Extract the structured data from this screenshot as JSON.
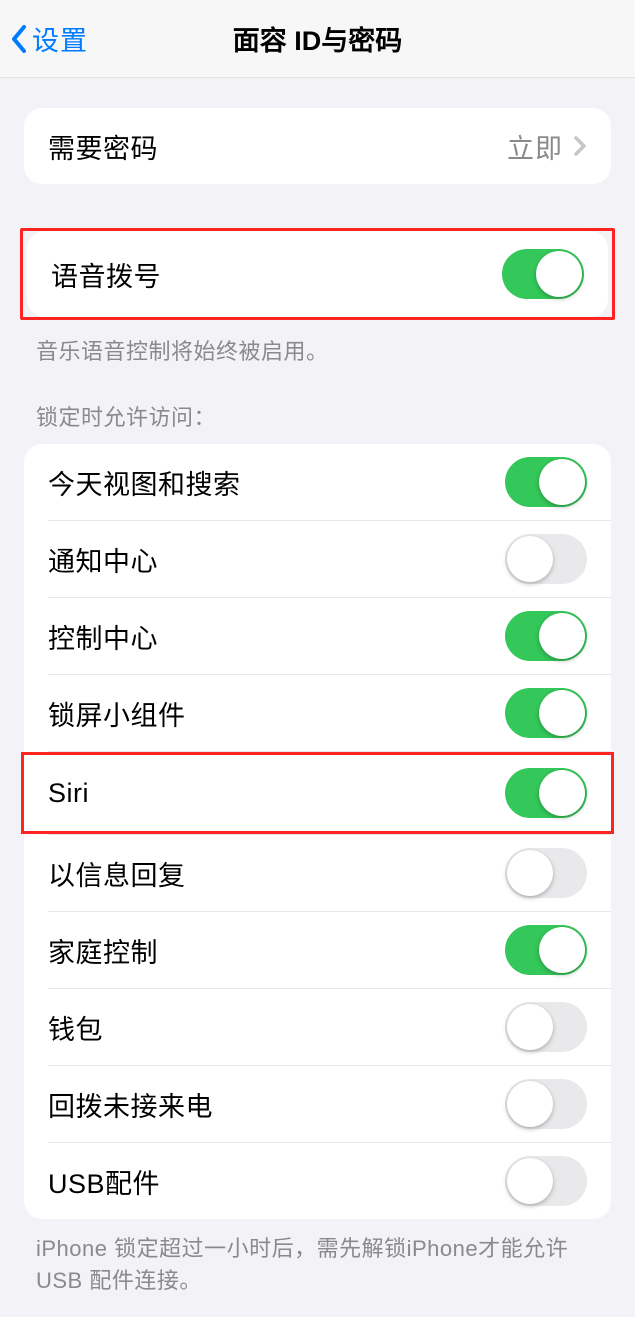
{
  "nav": {
    "back_label": "设置",
    "title": "面容 ID与密码"
  },
  "require_passcode": {
    "label": "需要密码",
    "value": "立即"
  },
  "voice_dial": {
    "label": "语音拨号",
    "footer": "音乐语音控制将始终被启用。"
  },
  "lock_section_header": "锁定时允许访问：",
  "lock_items": {
    "today": "今天视图和搜索",
    "notification": "通知中心",
    "control": "控制中心",
    "widgets": "锁屏小组件",
    "siri": "Siri",
    "reply": "以信息回复",
    "home": "家庭控制",
    "wallet": "钱包",
    "return_call": "回拨未接来电",
    "usb": "USB配件"
  },
  "usb_footer": "iPhone 锁定超过一小时后，需先解锁iPhone才能允许USB 配件连接。"
}
